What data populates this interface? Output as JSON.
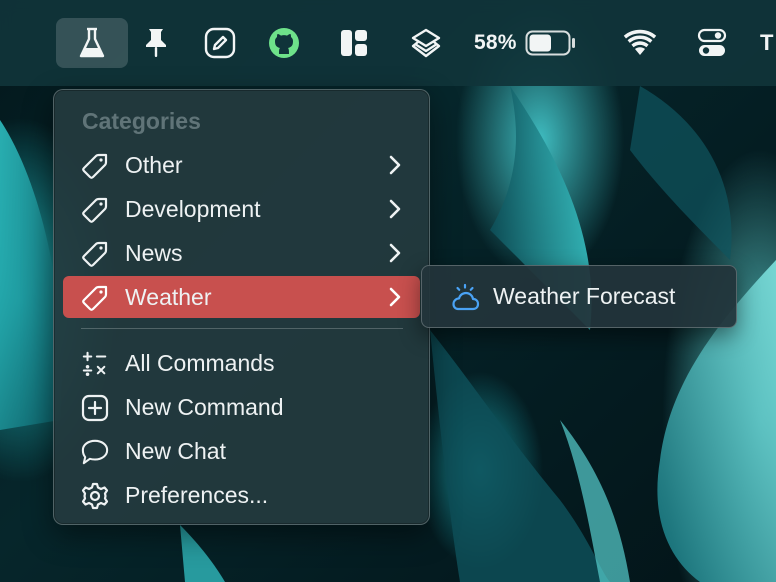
{
  "menubar": {
    "battery_percent": "58%",
    "battery_level": 0.58,
    "truncated_item": "T",
    "icons": [
      "flask-icon",
      "pin-icon",
      "edit-icon",
      "github-icon",
      "layout-icon",
      "layers-icon",
      "battery-icon",
      "wifi-icon",
      "control-center-icon"
    ]
  },
  "menu": {
    "header": "Categories",
    "categories": [
      {
        "label": "Other",
        "icon": "tag-icon",
        "submenu": true
      },
      {
        "label": "Development",
        "icon": "tag-icon",
        "submenu": true
      },
      {
        "label": "News",
        "icon": "tag-icon",
        "submenu": true
      },
      {
        "label": "Weather",
        "icon": "tag-icon",
        "submenu": true,
        "selected": true
      }
    ],
    "actions": [
      {
        "label": "All Commands",
        "icon": "calculator-icon"
      },
      {
        "label": "New Command",
        "icon": "plus-square-icon"
      },
      {
        "label": "New Chat",
        "icon": "chat-bubble-icon"
      },
      {
        "label": "Preferences...",
        "icon": "gear-icon"
      }
    ]
  },
  "submenu": {
    "items": [
      {
        "label": "Weather Forecast",
        "icon": "weather-cloud-icon"
      }
    ]
  },
  "colors": {
    "selected": "#c8504e",
    "github": "#6ee28a",
    "weather_icon": "#4aa3f5"
  }
}
